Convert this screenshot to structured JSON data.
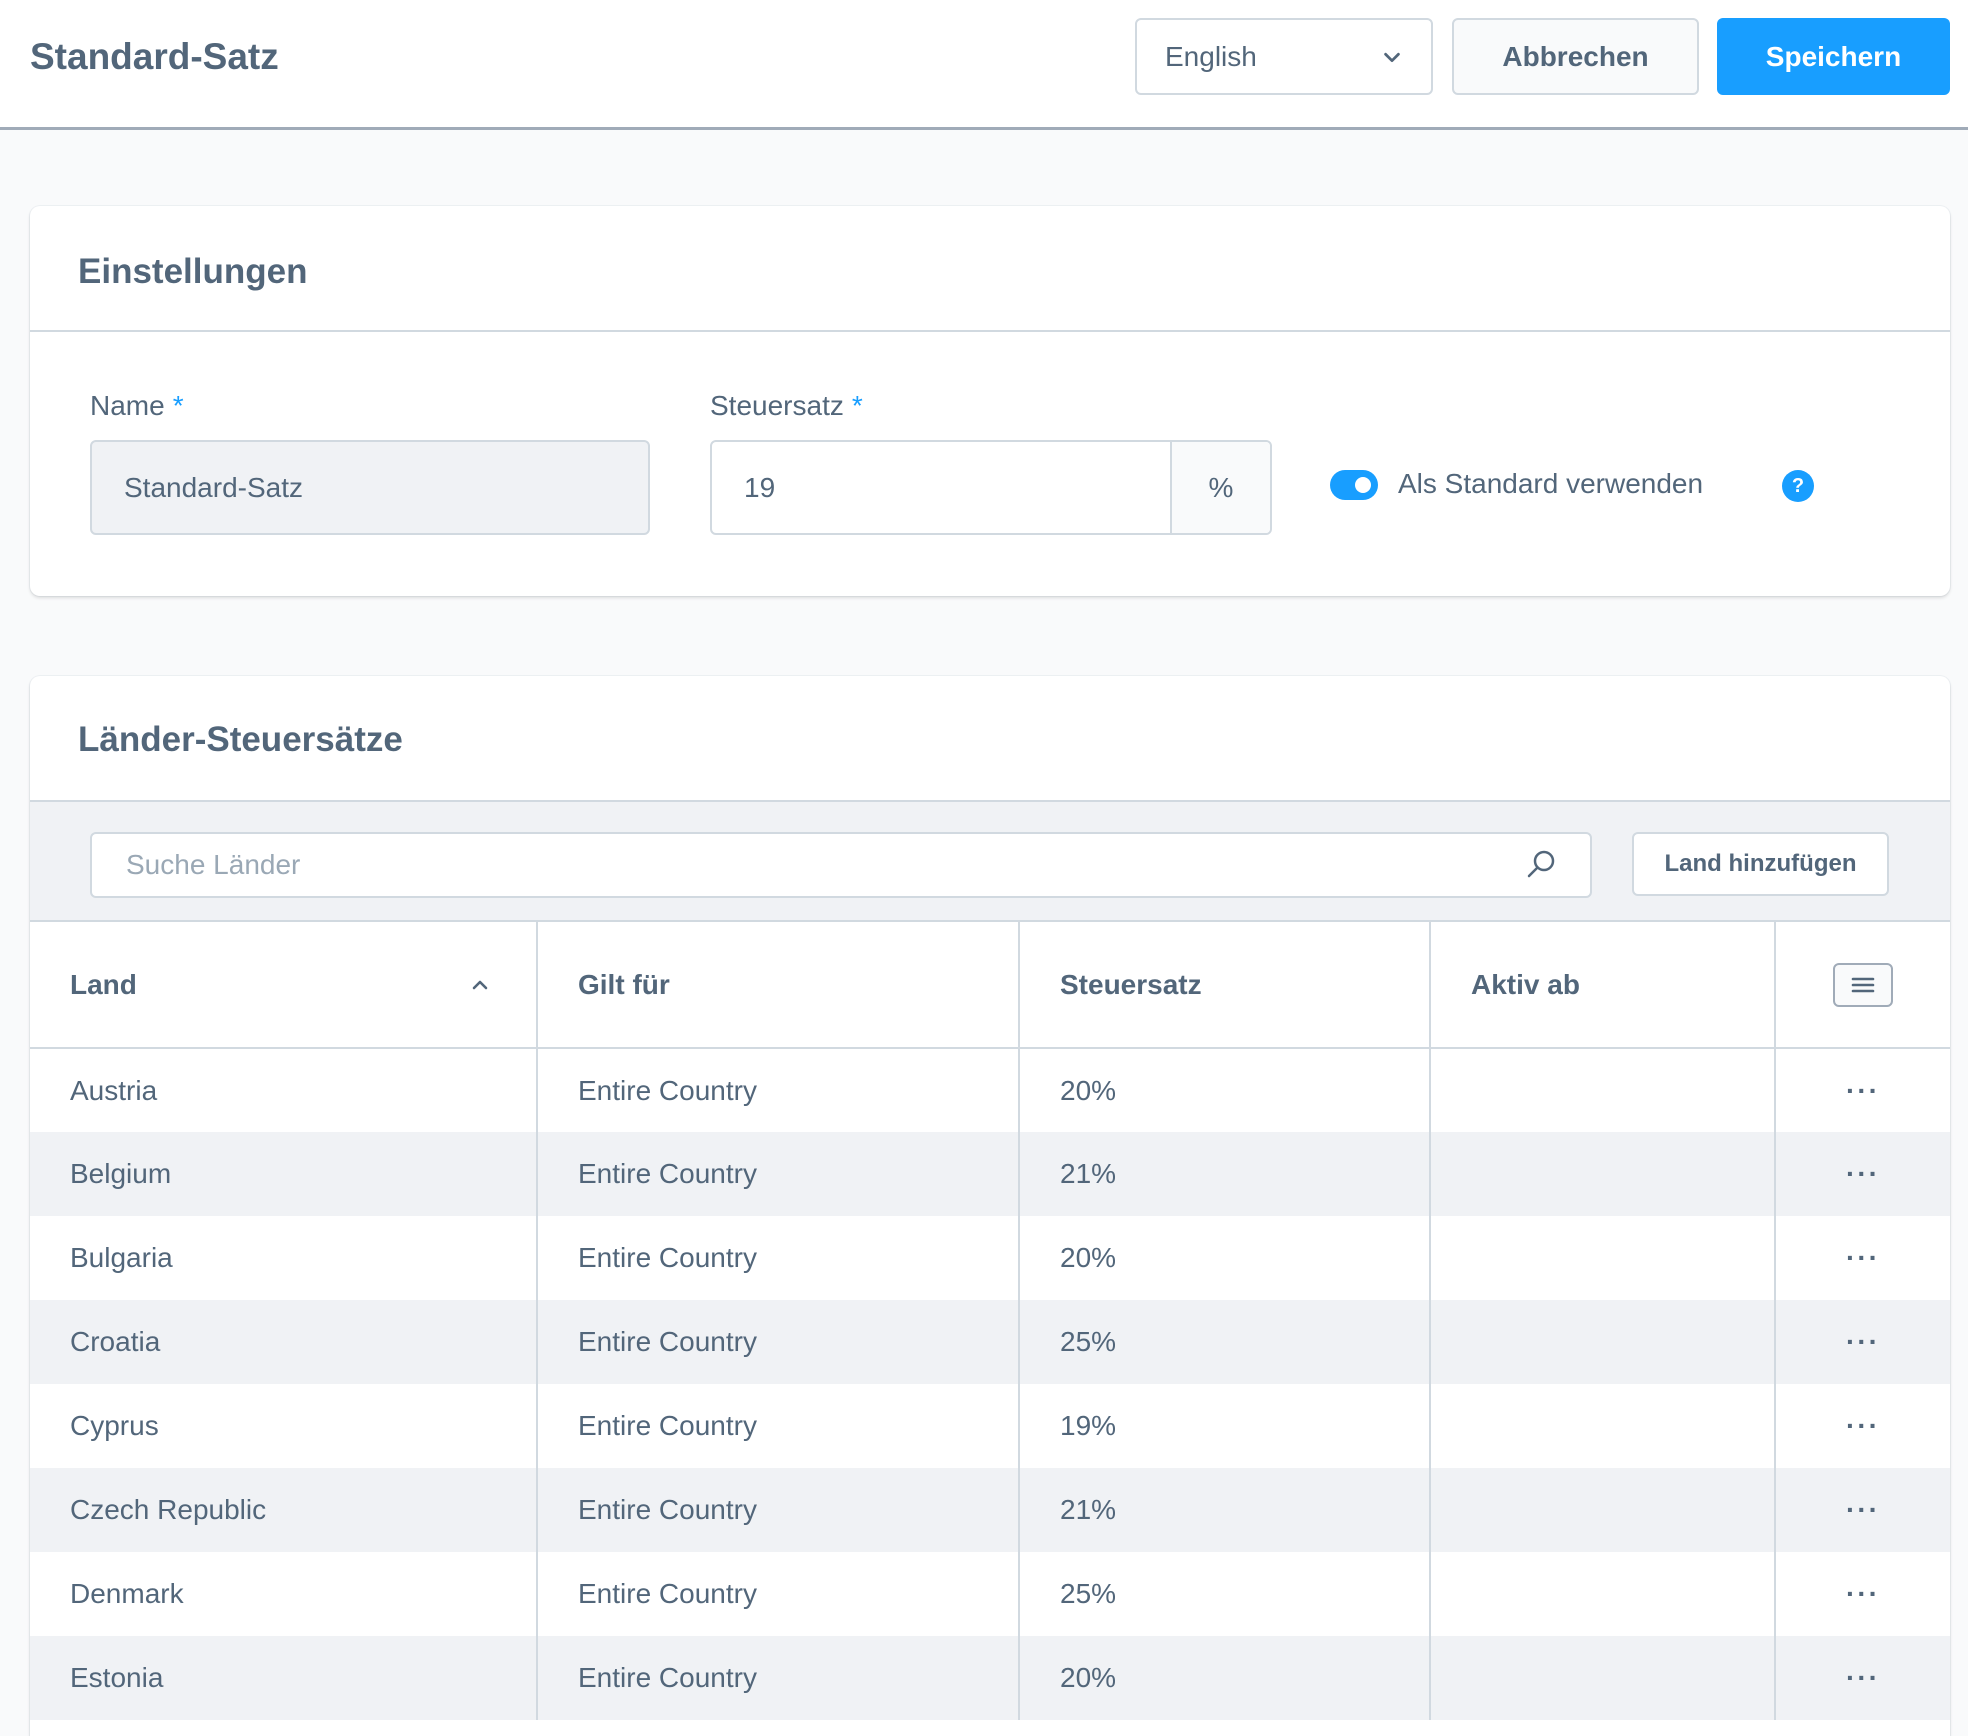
{
  "header": {
    "title": "Standard-Satz",
    "language": "English",
    "cancel_label": "Abbrechen",
    "save_label": "Speichern"
  },
  "settings": {
    "title": "Einstellungen",
    "name_label": "Name",
    "name_value": "Standard-Satz",
    "rate_label": "Steuersatz",
    "rate_value": "19",
    "rate_suffix": "%",
    "required_marker": "*",
    "default_toggle_label": "Als Standard verwenden",
    "default_toggle_on": true,
    "help_glyph": "?"
  },
  "countries": {
    "title": "Länder-Steuersätze",
    "search_placeholder": "Suche Länder",
    "add_label": "Land hinzufügen",
    "columns": [
      "Land",
      "Gilt für",
      "Steuersatz",
      "Aktiv ab"
    ],
    "rows": [
      {
        "country": "Austria",
        "applies": "Entire Country",
        "rate": "20%",
        "active": ""
      },
      {
        "country": "Belgium",
        "applies": "Entire Country",
        "rate": "21%",
        "active": ""
      },
      {
        "country": "Bulgaria",
        "applies": "Entire Country",
        "rate": "20%",
        "active": ""
      },
      {
        "country": "Croatia",
        "applies": "Entire Country",
        "rate": "25%",
        "active": ""
      },
      {
        "country": "Cyprus",
        "applies": "Entire Country",
        "rate": "19%",
        "active": ""
      },
      {
        "country": "Czech Republic",
        "applies": "Entire Country",
        "rate": "21%",
        "active": ""
      },
      {
        "country": "Denmark",
        "applies": "Entire Country",
        "rate": "25%",
        "active": ""
      },
      {
        "country": "Estonia",
        "applies": "Entire Country",
        "rate": "20%",
        "active": ""
      }
    ]
  },
  "icons": {
    "language_dropdown": "chevron-down-icon",
    "sort": "chevron-up-icon",
    "search": "search-icon",
    "column_settings": "menu-icon",
    "row_actions": "more-horizontal-icon",
    "help": "help-icon"
  },
  "colors": {
    "accent": "#189eff",
    "text": "#52667a",
    "border": "#d1d9e0",
    "stripe": "#f0f2f5"
  }
}
